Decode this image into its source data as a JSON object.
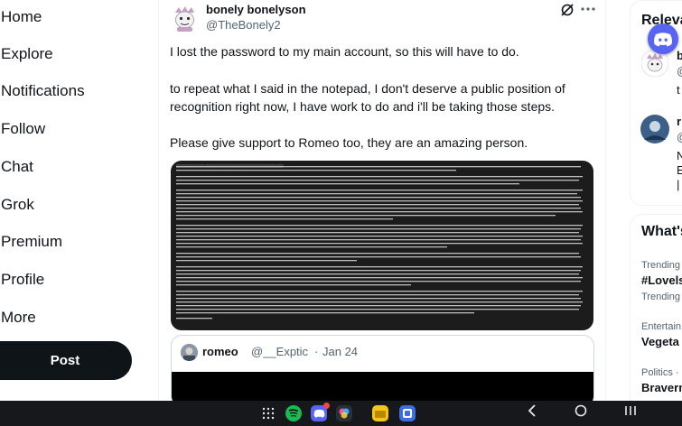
{
  "nav": {
    "items": [
      "Home",
      "Explore",
      "Notifications",
      "Follow",
      "Chat",
      "Grok",
      "Premium",
      "Profile",
      "More"
    ],
    "post_label": "Post"
  },
  "tweet": {
    "display_name": "bonely bonelyson",
    "handle": "@TheBonely2",
    "paragraphs": [
      "I lost the password to my main account, so this will have to do.",
      "to repeat what I said in the notepad, I don't deserve a public position of recognition right now, I have work to do and i'll be taking those steps.",
      "Please give support to Romeo too, they are an amazing person."
    ]
  },
  "quote": {
    "name": "romeo",
    "handle": "@__Exptic",
    "separator": "·",
    "date": "Jan 24"
  },
  "right": {
    "relevant_heading": "Relevant people",
    "person1": {
      "name": "b",
      "handle": "@",
      "bio": "t"
    },
    "person2": {
      "name": "r",
      "handle": "@",
      "bio_lines": [
        "N",
        "E",
        "|"
      ]
    },
    "whats_heading": "What's happening",
    "trends": [
      {
        "category": "Trending",
        "name": "#Lovels"
      },
      {
        "category": "Trending",
        "name": ""
      },
      {
        "category": "Entertain",
        "name": "Vegeta"
      },
      {
        "category": "Politics ·",
        "name": "Braverm"
      }
    ]
  },
  "colors": {
    "post_button": "#0f1419",
    "secondary_text": "#536471",
    "discord": "#5865f2",
    "android_bar": "#16181c"
  }
}
